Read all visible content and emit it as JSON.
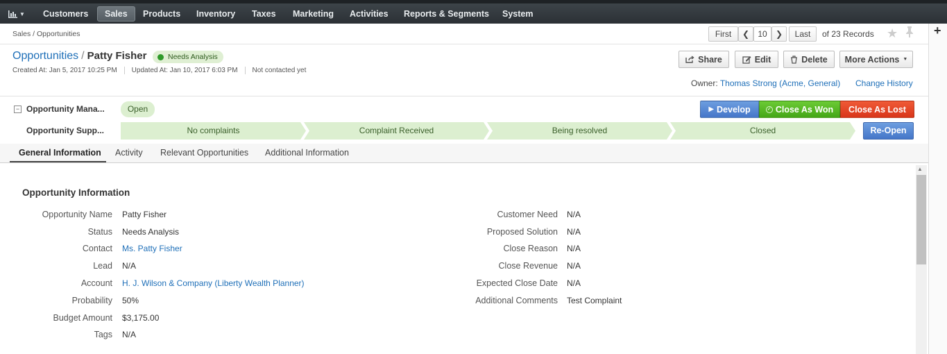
{
  "topnav": {
    "items": [
      "Customers",
      "Sales",
      "Products",
      "Inventory",
      "Taxes",
      "Marketing",
      "Activities",
      "Reports & Segments",
      "System"
    ],
    "active": "Sales"
  },
  "breadcrumb": "Sales / Opportunities",
  "pager": {
    "first": "First",
    "current": "10",
    "last": "Last",
    "records": "of 23 Records"
  },
  "header": {
    "entity_link": "Opportunities",
    "separator": "/",
    "name": "Patty Fisher",
    "status": "Needs Analysis",
    "created": "Created At: Jan 5, 2017 10:25 PM",
    "updated": "Updated At: Jan 10, 2017 6:03 PM",
    "contacted": "Not contacted yet"
  },
  "actions": {
    "share": "Share",
    "edit": "Edit",
    "delete": "Delete",
    "more": "More Actions"
  },
  "owner": {
    "label": "Owner:",
    "name": "Thomas Strong (Acme, General)",
    "change_history": "Change History"
  },
  "workflow": {
    "management_label": "Opportunity Mana...",
    "management_state": "Open",
    "support_label": "Opportunity Supp...",
    "buttons": {
      "develop": "Develop",
      "close_won": "Close As Won",
      "close_lost": "Close As Lost",
      "reopen": "Re-Open"
    },
    "stages": [
      "No complaints",
      "Complaint Received",
      "Being resolved",
      "Closed"
    ]
  },
  "tabs": [
    "General Information",
    "Activity",
    "Relevant Opportunities",
    "Additional Information"
  ],
  "section": {
    "title": "Opportunity Information",
    "left_fields": [
      {
        "label": "Opportunity Name",
        "value": "Patty Fisher"
      },
      {
        "label": "Status",
        "value": "Needs Analysis"
      },
      {
        "label": "Contact",
        "value": "Ms. Patty Fisher"
      },
      {
        "label": "Lead",
        "value": "N/A"
      },
      {
        "label": "Account",
        "value": "H. J. Wilson & Company (Liberty Wealth Planner)"
      },
      {
        "label": "Probability",
        "value": "50%"
      },
      {
        "label": "Budget Amount",
        "value": "$3,175.00"
      },
      {
        "label": "Tags",
        "value": "N/A"
      }
    ],
    "right_fields": [
      {
        "label": "Customer Need",
        "value": "N/A"
      },
      {
        "label": "Proposed Solution",
        "value": "N/A"
      },
      {
        "label": "Close Reason",
        "value": "N/A"
      },
      {
        "label": "Close Revenue",
        "value": "N/A"
      },
      {
        "label": "Expected Close Date",
        "value": "N/A"
      },
      {
        "label": "Additional Comments",
        "value": "Test Complaint"
      }
    ]
  },
  "colors": {
    "link": "#1e6fb8",
    "develop": "#4a7ccc",
    "close_won": "#4caa1c",
    "close_lost": "#de3b1e",
    "stage_fill": "#dcefd0"
  }
}
